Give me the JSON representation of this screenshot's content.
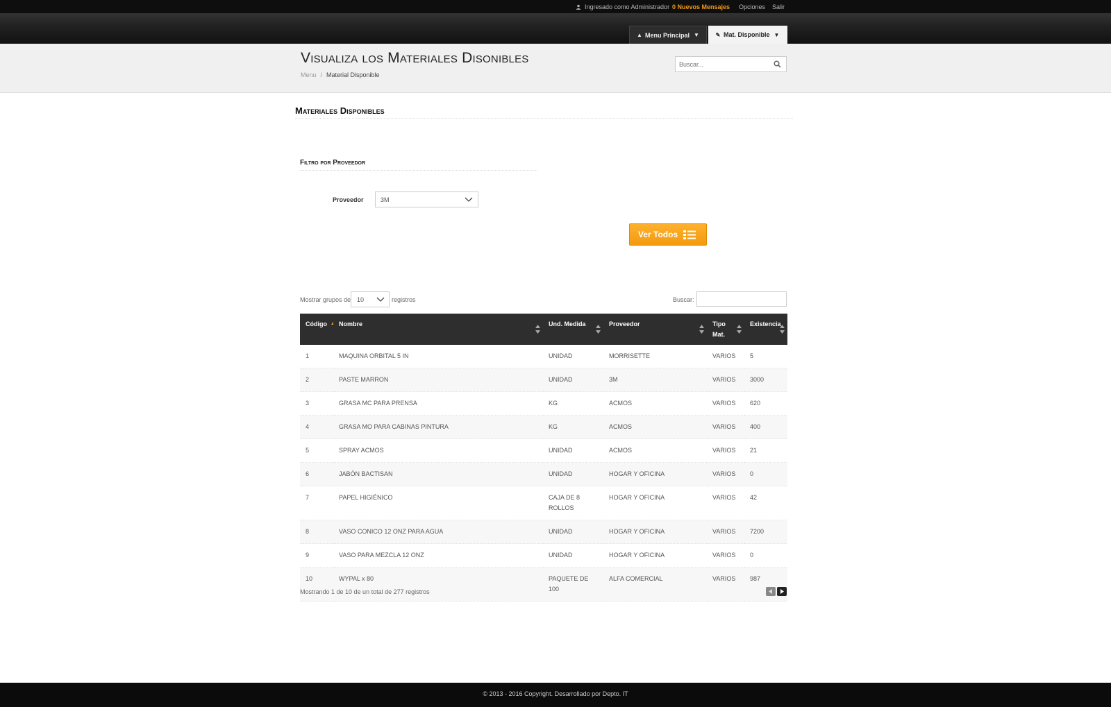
{
  "topbar": {
    "logged_in": "Ingresado como Administrador",
    "messages": "0 Nuevos Mensajes",
    "options": "Opciones",
    "exit": "Salir"
  },
  "nav": {
    "main_menu": "Menu Principal",
    "current": "Mat. Disponible"
  },
  "header": {
    "title": "Visualiza los Materiales Disonibles",
    "breadcrumb": [
      "Menu",
      "Material Disponible"
    ],
    "search_placeholder": "Buscar..."
  },
  "section": {
    "title": "Materiales Disponibles",
    "filter_title": "Filtro por Proveedor",
    "provider_label": "Proveedor",
    "provider_value": "3M",
    "view_all_button": "Ver Todos"
  },
  "table_controls": {
    "show_prefix": "Mostrar grupos de",
    "page_size": "10",
    "show_suffix": "registros",
    "search_label": "Buscar:"
  },
  "table": {
    "columns": [
      "Código",
      "Nombre",
      "Und. Medida",
      "Proveedor",
      "Tipo Mat.",
      "Existencia"
    ],
    "rows": [
      [
        "1",
        "MAQUINA ORBITAL 5 IN",
        "UNIDAD",
        "MORRISETTE",
        "VARIOS",
        "5"
      ],
      [
        "2",
        "PASTE MARRON",
        "UNIDAD",
        "3M",
        "VARIOS",
        "3000"
      ],
      [
        "3",
        "GRASA MC PARA PRENSA",
        "KG",
        "ACMOS",
        "VARIOS",
        "620"
      ],
      [
        "4",
        "GRASA MO PARA CABINAS PINTURA",
        "KG",
        "ACMOS",
        "VARIOS",
        "400"
      ],
      [
        "5",
        "SPRAY ACMOS",
        "UNIDAD",
        "ACMOS",
        "VARIOS",
        "21"
      ],
      [
        "6",
        "JABÓN BACTISAN",
        "UNIDAD",
        "HOGAR Y OFICINA",
        "VARIOS",
        "0"
      ],
      [
        "7",
        "PAPEL HIGIÉNICO",
        "CAJA DE 8 ROLLOS",
        "HOGAR Y OFICINA",
        "VARIOS",
        "42"
      ],
      [
        "8",
        "VASO CONICO 12 ONZ PARA AGUA",
        "UNIDAD",
        "HOGAR Y OFICINA",
        "VARIOS",
        "7200"
      ],
      [
        "9",
        "VASO PARA MEZCLA 12 ONZ",
        "UNIDAD",
        "HOGAR Y OFICINA",
        "VARIOS",
        "0"
      ],
      [
        "10",
        "WYPAL x 80",
        "PAQUETE DE 100",
        "ALFA COMERCIAL",
        "VARIOS",
        "987"
      ]
    ],
    "info": "Mostrando 1 de 10 de un total de 277 registros"
  },
  "footer": {
    "text": "© 2013 - 2016 Copyright. Desarrollado por Depto. IT"
  },
  "colors": {
    "accent": "#f39b13",
    "header_dark": "#2e2e2e"
  }
}
